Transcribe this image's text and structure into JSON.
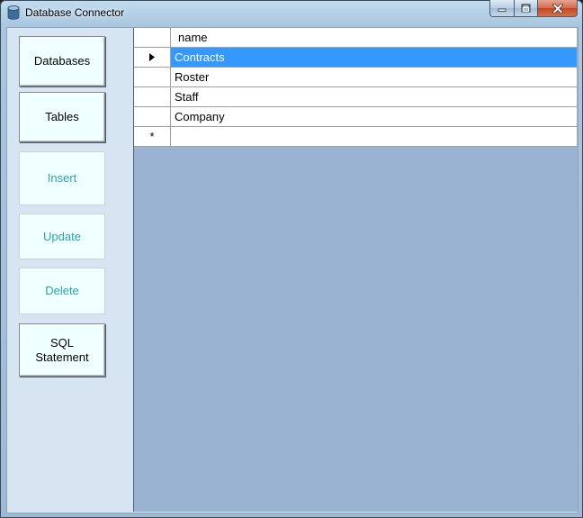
{
  "window": {
    "title": "Database Connector"
  },
  "buttons": {
    "databases": "Databases",
    "tables": "Tables",
    "insert": "Insert",
    "update": "Update",
    "delete": "Delete",
    "sql_line1": "SQL",
    "sql_line2": "Statement"
  },
  "grid": {
    "columns": [
      "name"
    ],
    "rows": [
      {
        "name": "Contracts",
        "selected": true,
        "indicator": "▸"
      },
      {
        "name": "Roster"
      },
      {
        "name": "Staff"
      },
      {
        "name": "Company"
      }
    ],
    "new_row_indicator": "*"
  },
  "colors": {
    "selection": "#3399ff",
    "grid_background": "#9ab3d2",
    "disabled_text": "#2aa5a5"
  }
}
